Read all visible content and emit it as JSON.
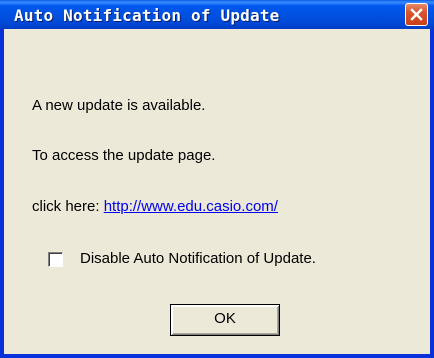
{
  "window": {
    "title": "Auto Notification of Update"
  },
  "message": {
    "line1": "A new update is available.",
    "line2": "To access the update page.",
    "line3_prefix": "click here:",
    "link_text": "http://www.edu.casio.com/"
  },
  "checkbox": {
    "label": "Disable Auto Notification of Update.",
    "checked": false
  },
  "buttons": {
    "ok_label": "OK"
  },
  "colors": {
    "titlebar": "#0058ee",
    "window_bg": "#ece9d8",
    "link": "#0000ee",
    "close_button": "#d7542b"
  },
  "icons": {
    "close": "close-icon"
  }
}
